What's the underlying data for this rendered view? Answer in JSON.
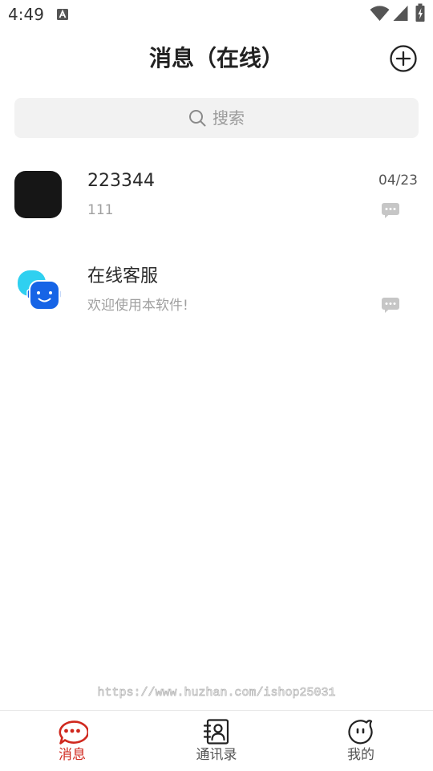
{
  "status_bar": {
    "time": "4:49",
    "icons": [
      "a-notification-icon",
      "wifi-icon",
      "signal-icon",
      "battery-icon"
    ]
  },
  "header": {
    "title": "消息（在线）",
    "add_icon": "plus-circle-icon"
  },
  "search": {
    "placeholder": "搜索",
    "icon": "search-icon"
  },
  "conversations": [
    {
      "name": "223344",
      "preview": "111",
      "date": "04/23",
      "avatar": "black-avatar",
      "action_icon": "chat-bubble-icon"
    },
    {
      "name": "在线客服",
      "preview": "欢迎使用本软件!",
      "avatar": "customer-service-avatar",
      "action_icon": "chat-bubble-icon"
    }
  ],
  "watermark": "https://www.huzhan.com/ishop25031",
  "tabs": [
    {
      "label": "消息",
      "icon": "message-icon",
      "active": true
    },
    {
      "label": "通讯录",
      "icon": "contacts-icon",
      "active": false
    },
    {
      "label": "我的",
      "icon": "profile-face-icon",
      "active": false
    }
  ],
  "colors": {
    "accent": "#d0281e",
    "text": "#222222",
    "muted": "#a0a0a0",
    "search_bg": "#f2f2f2",
    "cs_cyan": "#2fd0f0",
    "cs_blue": "#1664e6"
  }
}
